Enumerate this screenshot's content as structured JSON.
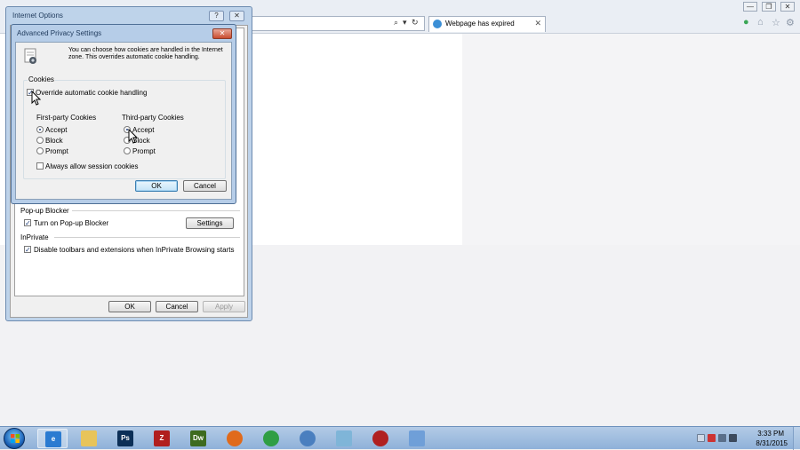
{
  "browser": {
    "tab_label": "Webpage has expired",
    "tab_close": "✕",
    "minimize": "—",
    "restore": "❐",
    "close": "✕",
    "search_glyph": "⌕",
    "dropdown_glyph": "▾",
    "refresh_glyph": "↻",
    "address_close": "✕"
  },
  "internet_options": {
    "title": "Internet Options",
    "help_glyph": "?",
    "close_glyph": "✕",
    "popup_section": "Pop-up Blocker",
    "popup_checkbox_label": "Turn on Pop-up Blocker",
    "settings_button": "Settings",
    "inprivate_section": "InPrivate",
    "inprivate_checkbox_label": "Disable toolbars and extensions when InPrivate Browsing starts",
    "ok_button": "OK",
    "cancel_button": "Cancel",
    "apply_button": "Apply",
    "checked_glyph": "✓"
  },
  "advanced_privacy": {
    "title": "Advanced Privacy Settings",
    "close_glyph": "✕",
    "description": "You can choose how cookies are handled in the Internet zone.  This overrides automatic cookie handling.",
    "cookies_legend": "Cookies",
    "override_label": "Override automatic cookie handling",
    "first_party_heading": "First-party Cookies",
    "third_party_heading": "Third-party Cookies",
    "first_party_options": [
      "Accept",
      "Block",
      "Prompt"
    ],
    "third_party_options": [
      "Accept",
      "Block",
      "Prompt"
    ],
    "first_party_selected": "Accept",
    "third_party_selected": "Accept",
    "session_label": "Always allow session cookies",
    "ok_button": "OK",
    "cancel_button": "Cancel",
    "checked_glyph": "✓"
  },
  "taskbar": {
    "items": [
      {
        "name": "internet-explorer",
        "glyph": "e",
        "color": "#2b7bd1"
      },
      {
        "name": "file-explorer",
        "glyph": "",
        "color": "#e8c45a"
      },
      {
        "name": "photoshop",
        "glyph": "Ps",
        "color": "#0c2f57"
      },
      {
        "name": "filezilla",
        "glyph": "Z",
        "color": "#b11e1e"
      },
      {
        "name": "dreamweaver",
        "glyph": "Dw",
        "color": "#3d6b1f"
      },
      {
        "name": "firefox",
        "glyph": "",
        "color": "#e06a1b"
      },
      {
        "name": "chrome",
        "glyph": "",
        "color": "#2f9e44"
      },
      {
        "name": "safari",
        "glyph": "",
        "color": "#4a7fbf"
      },
      {
        "name": "notes-app",
        "glyph": "",
        "color": "#7fb5d8"
      },
      {
        "name": "camtasia-recorder",
        "glyph": "",
        "color": "#b02020"
      },
      {
        "name": "document",
        "glyph": "",
        "color": "#6f9fd8"
      }
    ],
    "clock_time": "3:33 PM",
    "clock_date": "8/31/2015"
  }
}
